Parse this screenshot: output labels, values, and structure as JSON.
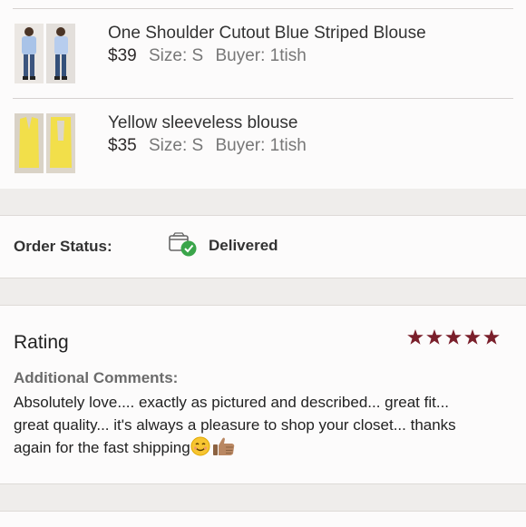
{
  "items": [
    {
      "title": "One Shoulder Cutout Blue Striped Blouse",
      "price": "$39",
      "size": "Size: S",
      "buyer": "Buyer: 1tish"
    },
    {
      "title": "Yellow sleeveless blouse",
      "price": "$35",
      "size": "Size: S",
      "buyer": "Buyer: 1tish"
    }
  ],
  "order_status": {
    "label": "Order Status:",
    "value": "Delivered"
  },
  "rating": {
    "label": "Rating",
    "stars": 5,
    "star_color": "#7a1f2b"
  },
  "comments": {
    "label": "Additional Comments:",
    "line1": "Absolutely love.... exactly as pictured and described... great fit...",
    "line2": "great quality... it's always a pleasure to shop your closet... thanks",
    "line3": "again for the fast shipping",
    "emojis": [
      "smiling-face",
      "thumbs-up"
    ]
  },
  "colors": {
    "delivered_check": "#3aa54a",
    "blouse_blue": "#a9c3e8",
    "blouse_yellow": "#f2df4a"
  }
}
